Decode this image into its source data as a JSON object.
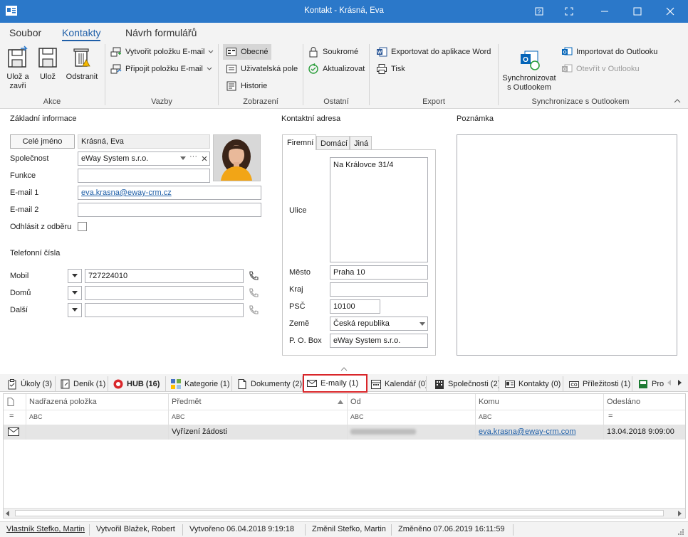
{
  "window": {
    "title": "Kontakt - Krásná, Eva"
  },
  "ribbon_tabs": [
    "Soubor",
    "Kontakty",
    "Návrh formulářů"
  ],
  "ribbon": {
    "akce": {
      "label": "Akce",
      "save_close": "Ulož a zavři",
      "save": "Ulož",
      "delete": "Odstranit"
    },
    "vazby": {
      "label": "Vazby",
      "create_email": "Vytvořit položku E-mail",
      "attach_email": "Připojit položku E-mail"
    },
    "zobrazeni": {
      "label": "Zobrazení",
      "general": "Obecné",
      "user_fields": "Uživatelská pole",
      "history": "Historie"
    },
    "ostatni": {
      "label": "Ostatní",
      "private": "Soukromé",
      "update": "Aktualizovat"
    },
    "export": {
      "label": "Export",
      "word": "Exportovat do aplikace Word",
      "print": "Tisk"
    },
    "sync": {
      "label": "Synchronizace s Outlookem",
      "sync_btn": "Synchronizovat s Outlookem",
      "import": "Importovat do Outlooku",
      "open": "Otevřít v Outlooku"
    }
  },
  "basic": {
    "section": "Základní informace",
    "fullname_btn": "Celé jméno",
    "fullname": "Krásná, Eva",
    "company_label": "Společnost",
    "company": "eWay System s.r.o.",
    "function_label": "Funkce",
    "function": "",
    "email1_label": "E-mail 1",
    "email1": "eva.krasna@eway-crm.cz",
    "email2_label": "E-mail 2",
    "email2": "",
    "unsubscribe_label": "Odhlásit z odběru"
  },
  "phones": {
    "section": "Telefonní čísla",
    "mobile_label": "Mobil",
    "mobile": "727224010",
    "home_label": "Domů",
    "home": "",
    "other_label": "Další",
    "other": ""
  },
  "address": {
    "section": "Kontaktní adresa",
    "tabs": [
      "Firemní",
      "Domácí",
      "Jiná"
    ],
    "street_label": "Ulice",
    "street": "Na Královce 31/4",
    "city_label": "Město",
    "city": "Praha 10",
    "region_label": "Kraj",
    "region": "",
    "zip_label": "PSČ",
    "zip": "10100",
    "country_label": "Země",
    "country": "Česká republika",
    "pobox_label": "P. O. Box",
    "pobox": "eWay System s.r.o."
  },
  "note": {
    "section": "Poznámka"
  },
  "bottom_tabs": [
    {
      "label": "Úkoly (3)"
    },
    {
      "label": "Deník (1)"
    },
    {
      "label": "HUB (16)"
    },
    {
      "label": "Kategorie (1)"
    },
    {
      "label": "Dokumenty (2)"
    },
    {
      "label": "E-maily (1)"
    },
    {
      "label": "Kalendář (0)"
    },
    {
      "label": "Společnosti (2)"
    },
    {
      "label": "Kontakty (0)"
    },
    {
      "label": "Příležitosti (1)"
    },
    {
      "label": "Pro"
    }
  ],
  "grid": {
    "columns": [
      "Nadřazená položka",
      "Předmět",
      "Od",
      "Komu",
      "Odesláno"
    ],
    "filter_text": "ABC",
    "row": {
      "parent": "",
      "subject": "Vyřízení žádosti",
      "from": "",
      "to": "eva.krasna@eway-crm.com",
      "sent": "13.04.2018 9:09:00"
    }
  },
  "status": {
    "owner": "Vlastník Stefko, Martin",
    "created_by": "Vytvořil Blažek, Robert",
    "created": "Vytvořeno 06.04.2018 9:19:18",
    "changed_by": "Změnil Stefko, Martin",
    "changed": "Změněno 07.06.2019 16:11:59"
  },
  "colors": {
    "titlebar": "#2b78c9",
    "accent": "#1f5fa8",
    "highlight": "#d9262a"
  }
}
